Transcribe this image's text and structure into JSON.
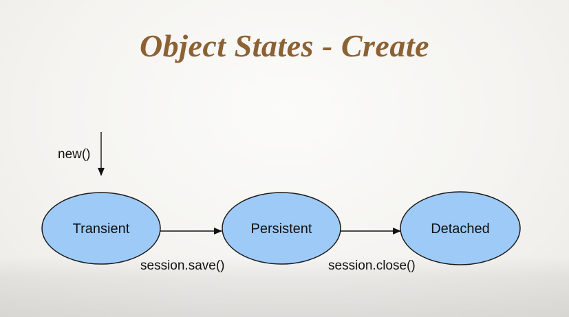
{
  "title": "Object States - Create",
  "colors": {
    "title": "#8c6133",
    "node_fill": "#9ecaf7",
    "node_stroke": "#1a1a1a",
    "text": "#111111"
  },
  "diagram": {
    "initial_edge": {
      "label": "new()",
      "target": "transient"
    },
    "nodes": [
      {
        "id": "transient",
        "label": "Transient"
      },
      {
        "id": "persistent",
        "label": "Persistent"
      },
      {
        "id": "detached",
        "label": "Detached"
      }
    ],
    "edges": [
      {
        "from": "transient",
        "to": "persistent",
        "label": "session.save()"
      },
      {
        "from": "persistent",
        "to": "detached",
        "label": "session.close()"
      }
    ]
  }
}
